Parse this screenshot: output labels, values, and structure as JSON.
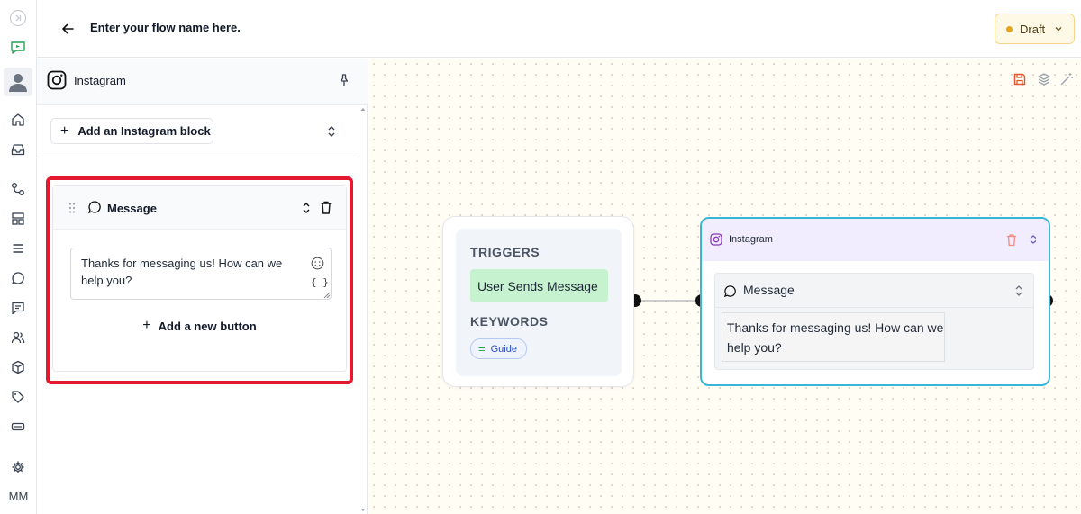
{
  "header": {
    "flow_name": "Enter your flow name here.",
    "status": "Draft"
  },
  "rail": {
    "user_initials": "MM"
  },
  "panel": {
    "title": "Instagram",
    "add_block_label": "Add an Instagram block",
    "message_block": {
      "label": "Message",
      "text": "Thanks for messaging us! How can we help you?",
      "variable_glyph": "{ }",
      "add_button_label": "Add a new button"
    }
  },
  "canvas": {
    "trigger_node": {
      "triggers_label": "TRIGGERS",
      "trigger": "User Sends Message",
      "keywords_label": "KEYWORDS",
      "keyword": "Guide"
    },
    "instagram_node": {
      "title": "Instagram",
      "message_label": "Message",
      "message_text": "Thanks for messaging us! How can we help you?"
    }
  },
  "colors": {
    "accent_red_highlight": "#e3192f",
    "node_border": "#38b6d8",
    "trigger_chip": "#c6f2cf",
    "draft_dot": "#e3a51c"
  },
  "icons": [
    "collapse-icon",
    "flow-icon",
    "user-avatar-icon",
    "home-icon",
    "inbox-icon",
    "workflow-icon",
    "layout-icon",
    "list-icon",
    "chat-icon",
    "message-square-icon",
    "contacts-icon",
    "box-icon",
    "tag-icon",
    "keyboard-icon",
    "settings-icon",
    "back-arrow-icon",
    "instagram-icon",
    "pin-icon",
    "plus-icon",
    "chevron-updown-icon",
    "drag-handle-icon",
    "trash-icon",
    "emoji-icon",
    "save-icon",
    "layers-icon",
    "magic-wand-icon"
  ]
}
